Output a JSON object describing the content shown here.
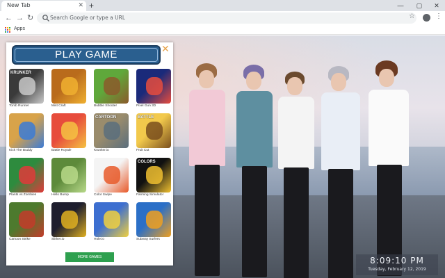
{
  "browser": {
    "tab_title": "New Tab",
    "tab_close": "✕",
    "new_tab": "+",
    "omnibox_placeholder": "Search Google or type a URL",
    "bookmark_apps": "Apps",
    "apps_colors": [
      "#ea4335",
      "#fbbc05",
      "#34a853",
      "#4285f4",
      "#ea4335",
      "#fbbc05",
      "#34a853",
      "#4285f4",
      "#ea4335"
    ]
  },
  "panel": {
    "title": "PLAY GAME",
    "close": "✕",
    "more_button": "MORE GAMES",
    "games": [
      {
        "name": "Tomb Runner",
        "colors": [
          "#3a3a3a",
          "#c9c9c9"
        ],
        "label": "KRUNKER"
      },
      {
        "name": "Mist Craft",
        "colors": [
          "#b96b1c",
          "#f0b030"
        ],
        "label": ""
      },
      {
        "name": "Bubble Shooter",
        "colors": [
          "#5fa83b",
          "#8b5a2b"
        ],
        "label": ""
      },
      {
        "name": "Pixel Gun 3D",
        "colors": [
          "#1a2a7a",
          "#e84c3d"
        ],
        "label": ""
      },
      {
        "name": "Kick The Buddy",
        "colors": [
          "#d8a34a",
          "#3b7bd6"
        ],
        "label": ""
      },
      {
        "name": "Battle Royale",
        "colors": [
          "#e74c3c",
          "#f5c242"
        ],
        "label": ""
      },
      {
        "name": "Krunker.io",
        "colors": [
          "#9a8c6c",
          "#5a6e7d"
        ],
        "label": "CARTOON"
      },
      {
        "name": "Fruit Cut",
        "colors": [
          "#f2c94c",
          "#7a4f1d"
        ],
        "label": "BATTLE"
      },
      {
        "name": "Plants vs Zombies",
        "colors": [
          "#2e8b3e",
          "#e03a3a"
        ],
        "label": ""
      },
      {
        "name": "Hello Bump",
        "colors": [
          "#5d8a3a",
          "#b8d98a"
        ],
        "label": ""
      },
      {
        "name": "Color Swipe",
        "colors": [
          "#f4f4f4",
          "#e85a2a"
        ],
        "label": ""
      },
      {
        "name": "Farming Simulator",
        "colors": [
          "#111111",
          "#f0c030"
        ],
        "label": "COLORS"
      },
      {
        "name": "Cartoon Strike",
        "colors": [
          "#4d7a2e",
          "#c33b2a"
        ],
        "label": ""
      },
      {
        "name": "Slither.io",
        "colors": [
          "#1e1e2e",
          "#e0b020"
        ],
        "label": ""
      },
      {
        "name": "Hole.io",
        "colors": [
          "#3d6fd0",
          "#f0d040"
        ],
        "label": ""
      },
      {
        "name": "Subway Surfers",
        "colors": [
          "#2b6fc7",
          "#f0a020"
        ],
        "label": ""
      }
    ]
  },
  "clock": {
    "time": "8:09:10 PM",
    "date": "Tuesday, February 12, 2019"
  }
}
